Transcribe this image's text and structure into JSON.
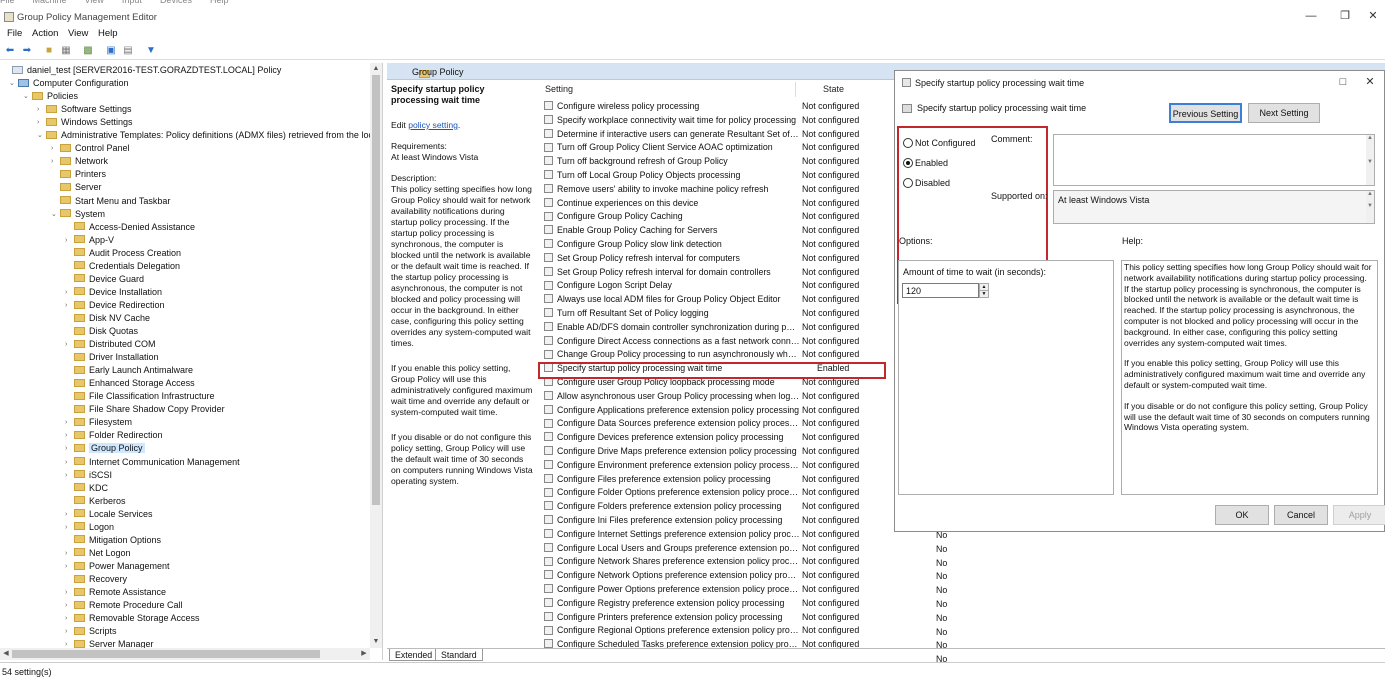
{
  "vm_menu": [
    "File",
    "Machine",
    "View",
    "Input",
    "Devices",
    "Help"
  ],
  "window": {
    "title": "Group Policy Management Editor"
  },
  "menu": {
    "file": "File",
    "action": "Action",
    "view": "View",
    "help": "Help"
  },
  "tree": {
    "root": "daniel_test [SERVER2016-TEST.GORAZDTEST.LOCAL] Policy",
    "computer_config": "Computer Configuration",
    "policies": "Policies",
    "software_settings": "Software Settings",
    "windows_settings": "Windows Settings",
    "admin_templates": "Administrative Templates: Policy definitions (ADMX files) retrieved from the local",
    "level3": [
      "Control Panel",
      "Network",
      "Printers",
      "Server",
      "Start Menu and Taskbar"
    ],
    "system": "System",
    "system_children": [
      "Access-Denied Assistance",
      "App-V",
      "Audit Process Creation",
      "Credentials Delegation",
      "Device Guard",
      "Device Installation",
      "Device Redirection",
      "Disk NV Cache",
      "Disk Quotas",
      "Distributed COM",
      "Driver Installation",
      "Early Launch Antimalware",
      "Enhanced Storage Access",
      "File Classification Infrastructure",
      "File Share Shadow Copy Provider",
      "Filesystem",
      "Folder Redirection",
      "Group Policy",
      "Internet Communication Management",
      "iSCSI",
      "KDC",
      "Kerberos",
      "Locale Services",
      "Logon",
      "Mitigation Options",
      "Net Logon",
      "Power Management",
      "Recovery",
      "Remote Assistance",
      "Remote Procedure Call",
      "Removable Storage Access",
      "Scripts",
      "Server Manager"
    ]
  },
  "status": {
    "count": "54 setting(s)"
  },
  "gp_header": "Group Policy",
  "description": {
    "title": "Specify startup policy processing wait time",
    "edit_prefix": "Edit ",
    "edit_link": "policy setting",
    "edit_suffix": ".",
    "requirements_label": "Requirements:",
    "requirements": "At least Windows Vista",
    "description_label": "Description:",
    "p1": "This policy setting specifies how long Group Policy should wait for network availability notifications during startup policy processing. If the startup policy processing is synchronous, the computer is blocked until the network is available or the default wait time is reached. If the startup policy processing is asynchronous, the computer is not blocked and policy processing will occur in the background. In either case, configuring this policy setting overrides any system-computed wait times.",
    "p2": "If you enable this policy setting, Group Policy will use this administratively configured maximum wait time and override any default or system-computed wait time.",
    "p3": "If you disable or do not configure this policy setting, Group Policy will use the default wait time of 30 seconds on computers running Windows Vista operating system."
  },
  "grid": {
    "col_setting": "Setting",
    "col_state": "State",
    "rows": [
      {
        "name": "Configure wireless policy processing",
        "state": "Not configured"
      },
      {
        "name": "Specify workplace connectivity wait time for policy processing",
        "state": "Not configured"
      },
      {
        "name": "Determine if interactive users can generate Resultant Set of Policy data",
        "state": "Not configured"
      },
      {
        "name": "Turn off Group Policy Client Service AOAC optimization",
        "state": "Not configured"
      },
      {
        "name": "Turn off background refresh of Group Policy",
        "state": "Not configured"
      },
      {
        "name": "Turn off Local Group Policy Objects processing",
        "state": "Not configured"
      },
      {
        "name": "Remove users' ability to invoke machine policy refresh",
        "state": "Not configured"
      },
      {
        "name": "Continue experiences on this device",
        "state": "Not configured"
      },
      {
        "name": "Configure Group Policy Caching",
        "state": "Not configured"
      },
      {
        "name": "Enable Group Policy Caching for Servers",
        "state": "Not configured"
      },
      {
        "name": "Configure Group Policy slow link detection",
        "state": "Not configured"
      },
      {
        "name": "Set Group Policy refresh interval for computers",
        "state": "Not configured"
      },
      {
        "name": "Set Group Policy refresh interval for domain controllers",
        "state": "Not configured"
      },
      {
        "name": "Configure Logon Script Delay",
        "state": "Not configured"
      },
      {
        "name": "Always use local ADM files for Group Policy Object Editor",
        "state": "Not configured"
      },
      {
        "name": "Turn off Resultant Set of Policy logging",
        "state": "Not configured"
      },
      {
        "name": "Enable AD/DFS domain controller synchronization during policy refresh",
        "state": "Not configured"
      },
      {
        "name": "Configure Direct Access connections as a fast network connection",
        "state": "Not configured"
      },
      {
        "name": "Change Group Policy processing to run asynchronously when a slow network connection is detected",
        "state": "Not configured"
      },
      {
        "name": "Specify startup policy processing wait time",
        "state": "Enabled"
      },
      {
        "name": "Configure user Group Policy loopback processing mode",
        "state": "Not configured"
      },
      {
        "name": "Allow asynchronous user Group Policy processing when logging on through Remote Desktop Services",
        "state": "Not configured"
      },
      {
        "name": "Configure Applications preference extension policy processing",
        "state": "Not configured"
      },
      {
        "name": "Configure Data Sources preference extension policy processing",
        "state": "Not configured"
      },
      {
        "name": "Configure Devices preference extension policy processing",
        "state": "Not configured"
      },
      {
        "name": "Configure Drive Maps preference extension policy processing",
        "state": "Not configured"
      },
      {
        "name": "Configure Environment preference extension policy processing",
        "state": "Not configured"
      },
      {
        "name": "Configure Files preference extension policy processing",
        "state": "Not configured"
      },
      {
        "name": "Configure Folder Options preference extension policy processing",
        "state": "Not configured"
      },
      {
        "name": "Configure Folders preference extension policy processing",
        "state": "Not configured"
      },
      {
        "name": "Configure Ini Files preference extension policy processing",
        "state": "Not configured"
      },
      {
        "name": "Configure Internet Settings preference extension policy processing",
        "state": "Not configured"
      },
      {
        "name": "Configure Local Users and Groups preference extension policy processing",
        "state": "Not configured"
      },
      {
        "name": "Configure Network Shares preference extension policy processing",
        "state": "Not configured"
      },
      {
        "name": "Configure Network Options preference extension policy processing",
        "state": "Not configured"
      },
      {
        "name": "Configure Power Options preference extension policy processing",
        "state": "Not configured"
      },
      {
        "name": "Configure Registry preference extension policy processing",
        "state": "Not configured"
      },
      {
        "name": "Configure Printers preference extension policy processing",
        "state": "Not configured"
      },
      {
        "name": "Configure Regional Options preference extension policy processing",
        "state": "Not configured"
      },
      {
        "name": "Configure Scheduled Tasks preference extension policy processing",
        "state": "Not configured"
      }
    ],
    "extra_col": [
      "No",
      "No",
      "No",
      "No",
      "No",
      "No",
      "No",
      "No",
      "No",
      "No"
    ]
  },
  "tabs": {
    "extended": "Extended",
    "standard": "Standard"
  },
  "dialog": {
    "title": "Specify startup policy processing wait time",
    "subtitle": "Specify startup policy processing wait time",
    "prev": "Previous Setting",
    "next": "Next Setting",
    "not_configured": "Not Configured",
    "enabled": "Enabled",
    "disabled": "Disabled",
    "comment_label": "Comment:",
    "supported_label": "Supported on:",
    "supported_value": "At least Windows Vista",
    "options_label": "Options:",
    "help_label": "Help:",
    "wait_label": "Amount of time to wait (in seconds):",
    "wait_value": "120",
    "help_p1": "This policy setting specifies how long Group Policy should wait for network availability notifications during startup policy processing. If the startup policy processing is synchronous, the computer is blocked until the network is available or the default wait time is reached. If the startup policy processing is asynchronous, the computer is not blocked and policy processing will occur in the background. In either case, configuring this policy setting overrides any system-computed wait times.",
    "help_p2": "If you enable this policy setting, Group Policy will use this administratively configured maximum wait time and override any default or system-computed wait time.",
    "help_p3": "If you disable or do not configure this policy setting, Group Policy will use the default wait time of 30 seconds on computers running Windows Vista operating system.",
    "ok": "OK",
    "cancel": "Cancel",
    "apply": "Apply"
  }
}
